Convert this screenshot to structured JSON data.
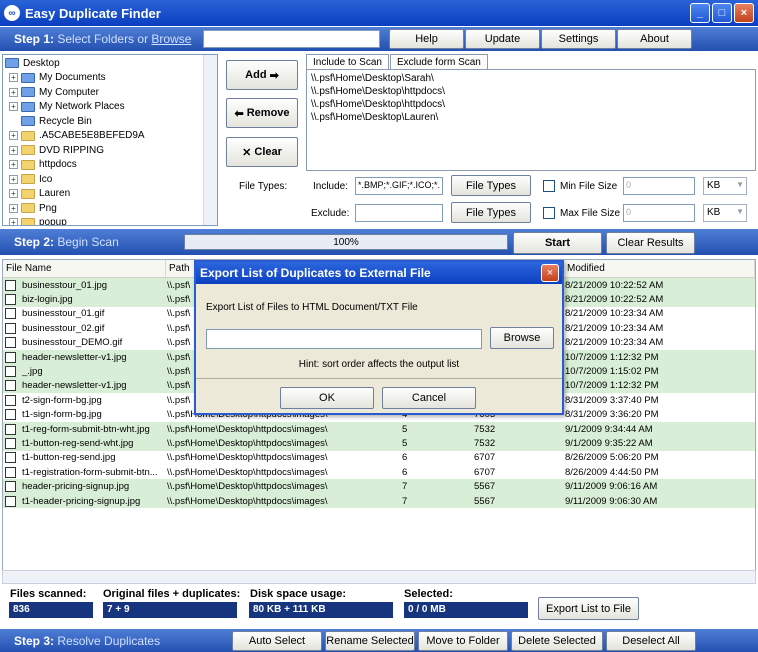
{
  "window": {
    "title": "Easy Duplicate Finder",
    "min": "_",
    "max": "□",
    "close": "×"
  },
  "step1": {
    "label": "Step 1:",
    "sub": "Select Folders or",
    "browse": "Browse",
    "help": "Help",
    "update": "Update",
    "settings": "Settings",
    "about": "About"
  },
  "tree": [
    "Desktop",
    "My Documents",
    "My Computer",
    "My Network Places",
    "Recycle Bin",
    ".A5CABE5E8BEFED9A",
    "DVD RIPPING",
    "httpdocs",
    "Ico",
    "Lauren",
    "Png",
    "popup"
  ],
  "buttons": {
    "add": "Add",
    "remove": "Remove",
    "clear": "Clear"
  },
  "tabs": {
    "include": "Include to Scan",
    "exclude": "Exclude form Scan"
  },
  "paths": [
    "\\\\.psf\\Home\\Desktop\\Sarah\\",
    "\\\\.psf\\Home\\Desktop\\httpdocs\\",
    "\\\\.psf\\Home\\Desktop\\httpdocs\\",
    "\\\\.psf\\Home\\Desktop\\Lauren\\"
  ],
  "filetypes": {
    "label": "File Types:",
    "include_label": "Include:",
    "include_value": "*.BMP;*.GIF;*.ICO;*.",
    "exclude_label": "Exclude:",
    "exclude_value": "",
    "btn": "File Types",
    "min_label": "Min File Size",
    "max_label": "Max File Size",
    "min_value": "0",
    "max_value": "0",
    "unit": "KB"
  },
  "step2": {
    "label": "Step 2:",
    "sub": "Begin Scan",
    "progress": "100%",
    "start": "Start",
    "clear": "Clear Results"
  },
  "grid": {
    "headers": [
      "File Name",
      "Path",
      "",
      "",
      "Modified"
    ],
    "rows": [
      {
        "name": "businesstour_01.jpg",
        "path": "\\\\.psf\\",
        "g": "",
        "size": "",
        "mod": "8/21/2009 10:22:52 AM",
        "alt": true
      },
      {
        "name": "biz-login.jpg",
        "path": "\\\\.psf\\",
        "g": "",
        "size": "",
        "mod": "8/21/2009 10:22:52 AM",
        "alt": true
      },
      {
        "name": "businesstour_01.gif",
        "path": "\\\\.psf\\",
        "g": "",
        "size": "",
        "mod": "8/21/2009 10:23:34 AM",
        "alt": false
      },
      {
        "name": "businesstour_02.gif",
        "path": "\\\\.psf\\",
        "g": "",
        "size": "",
        "mod": "8/21/2009 10:23:34 AM",
        "alt": false
      },
      {
        "name": "businesstour_DEMO.gif",
        "path": "\\\\.psf\\",
        "g": "",
        "size": "",
        "mod": "8/21/2009 10:23:34 AM",
        "alt": false
      },
      {
        "name": "header-newsletter-v1.jpg",
        "path": "\\\\.psf\\",
        "g": "",
        "size": "",
        "mod": "10/7/2009 1:12:32 PM",
        "alt": true
      },
      {
        "name": "_.jpg",
        "path": "\\\\.psf\\",
        "g": "",
        "size": "",
        "mod": "10/7/2009 1:15:02 PM",
        "alt": true
      },
      {
        "name": "header-newsletter-v1.jpg",
        "path": "\\\\.psf\\",
        "g": "",
        "size": "",
        "mod": "10/7/2009 1:12:32 PM",
        "alt": true
      },
      {
        "name": "t2-sign-form-bg.jpg",
        "path": "\\\\.psf\\",
        "g": "",
        "size": "",
        "mod": "8/31/2009 3:37:40 PM",
        "alt": false
      },
      {
        "name": "t1-sign-form-bg.jpg",
        "path": "\\\\.psf\\Home\\Desktop\\httpdocs\\images\\",
        "g": "4",
        "size": "7603",
        "mod": "8/31/2009 3:36:20 PM",
        "alt": false
      },
      {
        "name": "t1-reg-form-submit-btn-wht.jpg",
        "path": "\\\\.psf\\Home\\Desktop\\httpdocs\\images\\",
        "g": "5",
        "size": "7532",
        "mod": "9/1/2009 9:34:44 AM",
        "alt": true
      },
      {
        "name": "t1-button-reg-send-wht.jpg",
        "path": "\\\\.psf\\Home\\Desktop\\httpdocs\\images\\",
        "g": "5",
        "size": "7532",
        "mod": "9/1/2009 9:35:22 AM",
        "alt": true
      },
      {
        "name": "t1-button-reg-send.jpg",
        "path": "\\\\.psf\\Home\\Desktop\\httpdocs\\images\\",
        "g": "6",
        "size": "6707",
        "mod": "8/26/2009 5:06:20 PM",
        "alt": false
      },
      {
        "name": "t1-registration-form-submit-btn...",
        "path": "\\\\.psf\\Home\\Desktop\\httpdocs\\images\\",
        "g": "6",
        "size": "6707",
        "mod": "8/26/2009 4:44:50 PM",
        "alt": false
      },
      {
        "name": "header-pricing-signup.jpg",
        "path": "\\\\.psf\\Home\\Desktop\\httpdocs\\images\\",
        "g": "7",
        "size": "5567",
        "mod": "9/11/2009 9:06:16 AM",
        "alt": true
      },
      {
        "name": "t1-header-pricing-signup.jpg",
        "path": "\\\\.psf\\Home\\Desktop\\httpdocs\\images\\",
        "g": "7",
        "size": "5567",
        "mod": "9/11/2009 9:06:30 AM",
        "alt": true
      }
    ]
  },
  "status": {
    "scanned_label": "Files scanned:",
    "scanned": "836",
    "orig_label": "Original files + duplicates:",
    "orig": "7 + 9",
    "disk_label": "Disk space usage:",
    "disk": "80 KB + 111 KB",
    "sel_label": "Selected:",
    "sel": "0 / 0 MB",
    "export": "Export List to File"
  },
  "step3": {
    "label": "Step 3:",
    "sub": "Resolve Duplicates",
    "auto": "Auto Select",
    "rename": "Rename Selected",
    "move": "Move to Folder",
    "delete": "Delete Selected",
    "deselect": "Deselect All"
  },
  "dialog": {
    "title": "Export List of Duplicates to External File",
    "desc": "Export List of Files to HTML Document/TXT File",
    "path": "",
    "browse": "Browse",
    "hint": "Hint: sort order affects the output list",
    "ok": "OK",
    "cancel": "Cancel",
    "close": "×"
  },
  "colors": {
    "title": "#0a3ec0",
    "stepbar": "#2350b0",
    "rowalt": "#d8eed6",
    "statusval": "#17357e"
  }
}
